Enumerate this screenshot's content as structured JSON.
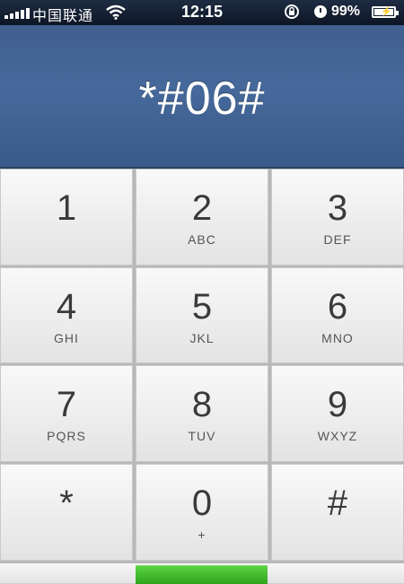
{
  "status_bar": {
    "carrier": "中国联通",
    "time": "12:15",
    "battery_percent": "99%",
    "icons": [
      "signal-icon",
      "wifi-icon",
      "rotation-lock-icon",
      "alarm-icon",
      "battery-charging-icon"
    ]
  },
  "display": {
    "number": "*#06#"
  },
  "keypad": {
    "keys": [
      {
        "digit": "1",
        "letters": ""
      },
      {
        "digit": "2",
        "letters": "ABC"
      },
      {
        "digit": "3",
        "letters": "DEF"
      },
      {
        "digit": "4",
        "letters": "GHI"
      },
      {
        "digit": "5",
        "letters": "JKL"
      },
      {
        "digit": "6",
        "letters": "MNO"
      },
      {
        "digit": "7",
        "letters": "PQRS"
      },
      {
        "digit": "8",
        "letters": "TUV"
      },
      {
        "digit": "9",
        "letters": "WXYZ"
      },
      {
        "digit": "*",
        "letters": ""
      },
      {
        "digit": "0",
        "letters": "+"
      },
      {
        "digit": "#",
        "letters": ""
      }
    ]
  },
  "colors": {
    "display_bg": "#46699b",
    "key_bg": "#f0f0f0",
    "call_green": "#3fb52a"
  }
}
